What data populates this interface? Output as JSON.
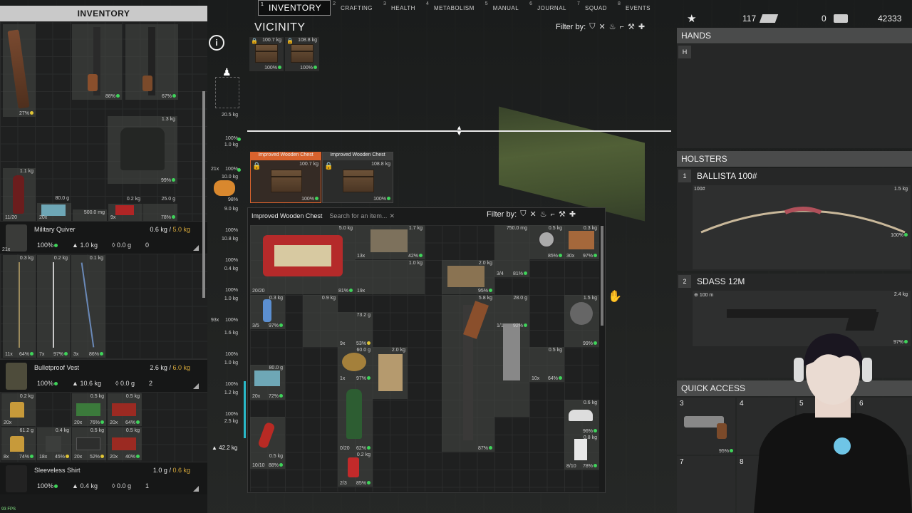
{
  "tabs": [
    {
      "num": "1",
      "label": "INVENTORY",
      "active": true
    },
    {
      "num": "2",
      "label": "CRAFTING"
    },
    {
      "num": "3",
      "label": "HEALTH"
    },
    {
      "num": "4",
      "label": "METABOLISM"
    },
    {
      "num": "5",
      "label": "MANUAL"
    },
    {
      "num": "6",
      "label": "JOURNAL"
    },
    {
      "num": "7",
      "label": "SQUAD"
    },
    {
      "num": "8",
      "label": "EVENTS"
    }
  ],
  "inventory": {
    "title": "INVENTORY",
    "top_items": [
      {
        "name": "rifle-stock",
        "pct": "27%"
      },
      {
        "name": "ak-rifle",
        "pct": "88%"
      },
      {
        "name": "ak-rifle-2",
        "pct": "67%"
      },
      {
        "name": "jacket",
        "weight": "1.3 kg",
        "pct": "99%"
      },
      {
        "name": "bottle",
        "weight": "1.1 kg",
        "count": "11/20"
      },
      {
        "name": "ammo-box",
        "weight": "80.0 g",
        "count": "20x"
      },
      {
        "name": "canteen",
        "weight": "500.0 mg",
        "count": "2 /..."
      },
      {
        "name": "shells",
        "weight": "0.2 kg",
        "count": "50%"
      },
      {
        "name": "bandage",
        "weight": "25.0 g",
        "count": "9x",
        "pct": "72%"
      },
      {
        "name": "tape",
        "count": "1/1",
        "pct": "78%"
      }
    ],
    "quiver": {
      "name": "Military Quiver",
      "weight": "0.6 kg",
      "capacity": "5.0 kg",
      "count": "21x",
      "durability": "100%",
      "armor": "1.0 kg",
      "water": "0.0 g",
      "extra": "0",
      "arrows": [
        {
          "weight": "0.3 kg",
          "count": "11x",
          "pct": "64%"
        },
        {
          "weight": "0.2 kg",
          "count": "7x",
          "pct": "97%"
        },
        {
          "weight": "0.1 kg",
          "count": "3x",
          "pct": "86%"
        }
      ]
    },
    "vest": {
      "name": "Bulletproof Vest",
      "weight": "2.6 kg",
      "capacity": "6.0 kg",
      "durability": "100%",
      "armor": "10.6 kg",
      "water": "0.0 g",
      "extra": "2",
      "items": [
        {
          "weight": "0.2 kg",
          "count": "20x",
          "pct": "5x"
        },
        {
          "weight": "0.5 kg",
          "count": "20x",
          "pct": "76%"
        },
        {
          "weight": "0.5 kg",
          "count": "20x",
          "pct": "64%"
        },
        {
          "weight": "61.2 g",
          "count": "8x",
          "pct": "74%"
        },
        {
          "weight": "0.4 kg",
          "count": "18x",
          "pct": "45%"
        },
        {
          "weight": "0.5 kg",
          "count": "20x",
          "pct": "52%"
        },
        {
          "weight": "0.5 kg",
          "count": "20x",
          "pct": "40%"
        }
      ]
    },
    "shirt": {
      "name": "Sleeveless Shirt",
      "weight": "1.0 g",
      "capacity": "0.6 kg",
      "durability": "100%",
      "armor": "0.4 kg",
      "water": "0.0 g",
      "extra": "1"
    }
  },
  "sidebar": {
    "weights": [
      "20.5 kg",
      "1.0 kg",
      "10.0 kg",
      "9.0 kg",
      "10.8 kg",
      "0.4 kg",
      "1.0 kg",
      "1.6 kg",
      "1.0 kg",
      "1.2 kg",
      "2.5 kg"
    ],
    "pcts": [
      "100%",
      "100%",
      "100%",
      "98%",
      "100%",
      "100%",
      "100%",
      "100%",
      "100%",
      "100%",
      "100%"
    ],
    "counts": [
      "21x",
      "",
      "",
      "",
      "",
      "",
      "",
      "93x",
      "",
      "",
      ""
    ],
    "total_weight": "42.2 kg"
  },
  "vicinity": {
    "title": "VICINITY",
    "filter_label": "Filter by:",
    "top_crates": [
      {
        "weight": "100.7 kg",
        "pct": "100%"
      },
      {
        "weight": "108.8 kg",
        "pct": "100%"
      }
    ],
    "chests": [
      {
        "title": "Improved Wooden Chest",
        "weight": "100.7 kg",
        "pct": "100%",
        "selected": true
      },
      {
        "title": "Improved Wooden Chest",
        "weight": "108.8 kg",
        "pct": "100%",
        "selected": false
      }
    ]
  },
  "container": {
    "title": "Improved Wooden Chest",
    "search_placeholder": "Search for an item...",
    "filter_label": "Filter by:",
    "items": [
      {
        "name": "repair-kit",
        "weight": "5.0 kg",
        "count": "20/20",
        "pct": "81%"
      },
      {
        "name": "bolts",
        "weight": "1.7 kg",
        "count": "13x",
        "pct": "42%"
      },
      {
        "name": "iron-nails",
        "weight": "2.0 kg",
        "count": "19x",
        "pct": "95%"
      },
      {
        "name": "revolver-parts",
        "weight": "1.0 kg",
        "count": "",
        "pct": ""
      },
      {
        "name": "battery",
        "weight": "750.0 mg",
        "count": "3/4",
        "pct": "81%"
      },
      {
        "name": "compass",
        "weight": "0.5 kg",
        "count": "",
        "pct": "85%"
      },
      {
        "name": "ammo-ap",
        "weight": "0.3 kg",
        "count": "30x",
        "pct": "97%"
      },
      {
        "name": "water-bottle",
        "weight": "0.3 kg",
        "count": "3/5",
        "pct": "97%"
      },
      {
        "name": "lighter",
        "weight": "0.9 kg",
        "count": "",
        "pct": ""
      },
      {
        "name": "cigarettes",
        "weight": "73.2 g",
        "count": "9x",
        "pct": "53%"
      },
      {
        "name": "pan",
        "weight": "1.5 kg",
        "count": "",
        "pct": "99%"
      },
      {
        "name": "bread",
        "weight": "60.0 g",
        "count": "1x",
        "pct": "97%"
      },
      {
        "name": "paper",
        "weight": "2.0 kg",
        "count": "",
        "pct": ""
      },
      {
        "name": "rifle",
        "weight": "5.8 kg",
        "count": "",
        "pct": "87%"
      },
      {
        "name": "cleaver",
        "weight": "28.0 g",
        "count": "1/1",
        "pct": "92%"
      },
      {
        "name": "crossbow",
        "weight": "0.5 kg",
        "count": "10x",
        "pct": "64%"
      },
      {
        "name": "ammo-box-2",
        "weight": "80.0 g",
        "count": "20x",
        "pct": "72%"
      },
      {
        "name": "glass-bottle",
        "weight": "",
        "count": "0/20",
        "pct": "62%"
      },
      {
        "name": "sneakers",
        "weight": "0.6 kg",
        "count": "",
        "pct": "96%"
      },
      {
        "name": "milk",
        "weight": "0.8 kg",
        "count": "8/10",
        "pct": "78%"
      },
      {
        "name": "ketchup",
        "weight": "0.5 kg",
        "count": "10/10",
        "pct": "88%"
      },
      {
        "name": "soda-can",
        "weight": "0.2 kg",
        "count": "2/3",
        "pct": "85%"
      }
    ]
  },
  "right": {
    "stats": {
      "level": "117",
      "money1": "0",
      "money2": "42333"
    },
    "hands": {
      "title": "HANDS",
      "slot_label": "H"
    },
    "holsters": {
      "title": "HOLSTERS",
      "weapons": [
        {
          "num": "1",
          "name": "BALLISTA 100#",
          "ammo": "100#",
          "weight": "1.5 kg",
          "pct": "100%"
        },
        {
          "num": "2",
          "name": "SDASS 12M",
          "ammo": "100 m",
          "weight": "2.4 kg",
          "pct": "97%"
        }
      ]
    },
    "quick_access": {
      "title": "QUICK ACCESS",
      "slots": [
        {
          "num": "3",
          "pct": "95%"
        },
        {
          "num": "4",
          "pct": ""
        },
        {
          "num": "5",
          "pct": ""
        },
        {
          "num": "6",
          "pct": ""
        },
        {
          "num": "7",
          "pct": ""
        },
        {
          "num": "8",
          "pct": ""
        }
      ]
    }
  },
  "fps": "93 FPS",
  "colors": {
    "accent": "#d8622d",
    "good": "#3fd35a",
    "warn": "#d5a73a",
    "header": "#c9c9c9"
  }
}
